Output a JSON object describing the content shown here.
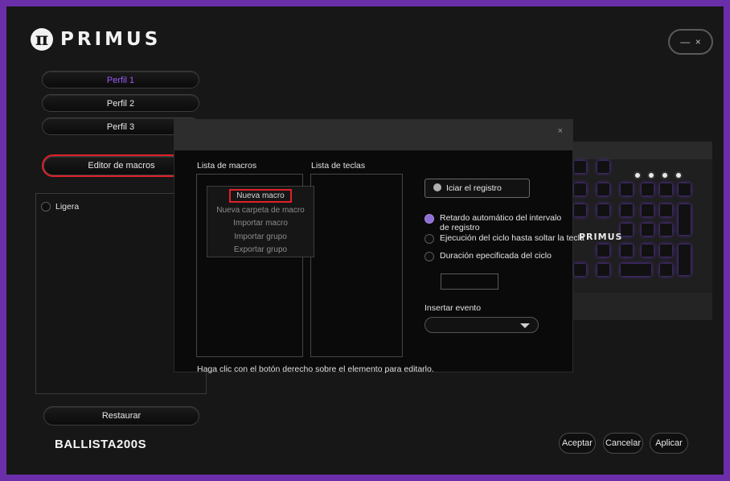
{
  "app": {
    "logo_glyph": "π",
    "brand": "PRIMUS",
    "window_controls": {
      "minimize": "—",
      "close": "×"
    }
  },
  "profiles": [
    {
      "label": "Perfil 1",
      "active": true
    },
    {
      "label": "Perfil 2",
      "active": false
    },
    {
      "label": "Perfil 3",
      "active": false
    }
  ],
  "macro_editor_button": "Editor de macros",
  "lighting_options": [
    {
      "label": "Ligera"
    }
  ],
  "restore_button": "Restaurar",
  "model_name": "BALLISTA200S",
  "footer_buttons": {
    "accept": "Aceptar",
    "cancel": "Cancelar",
    "apply": "Aplicar"
  },
  "dialog": {
    "close_glyph": "×",
    "macro_list_label": "Lista de macros",
    "key_list_label": "Lista de teclas",
    "context_menu": [
      "Nueva macro",
      "Nueva carpeta de macro",
      "Importar macro",
      "Importar grupo",
      "Exportar grupo"
    ],
    "record_button": "Iciar el registro",
    "options": [
      {
        "label": "Retardo automático del intervalo de registro",
        "selected": true
      },
      {
        "label": "Ejecución del ciclo hasta soltar la tecla",
        "selected": false
      },
      {
        "label": "Duración epecificada del ciclo",
        "selected": false
      }
    ],
    "duration_value": "",
    "insert_event_label": "Insertar evento",
    "insert_event_value": "",
    "hint": "Haga clic con el botón derecho sobre el elemento para editarlo."
  },
  "keyboard": {
    "logo": "PRIMUS"
  },
  "colors": {
    "frame": "#6a2fa8",
    "accent": "#9b5cf6",
    "highlight": "#e0202a",
    "background": "#171717"
  }
}
